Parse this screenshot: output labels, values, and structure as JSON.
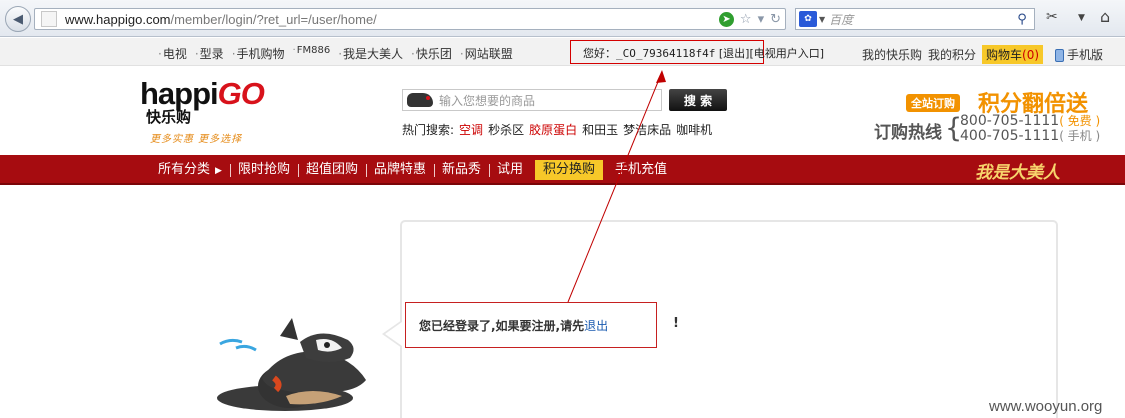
{
  "browser": {
    "url_domain": "www.happigo.com",
    "url_path": "/member/login/?ret_url=/user/home/",
    "search_placeholder": "百度"
  },
  "topbar": {
    "links": [
      "电视",
      "型录",
      "手机购物",
      "FM886",
      "我是大美人",
      "快乐团",
      "网站联盟"
    ],
    "greeting": "您好：",
    "user_id": "_CO_79364118f4f",
    "logout": "[退出]",
    "tv_entry": "[电视用户入口]",
    "my_happy_shop": "我的快乐购",
    "my_points": "我的积分",
    "cart_label": "购物车",
    "cart_count": "(0)",
    "mobile": "手机版"
  },
  "header": {
    "logo_text": "happi",
    "logo_go": "GO",
    "logo_chinese": "快乐购",
    "logo_tagline": "更多实惠 更多选择",
    "search_placeholder": "输入您想要的商品",
    "search_button": "搜 索",
    "hot_label": "热门搜索:",
    "hot_terms": [
      "空调",
      "秒杀区",
      "胶原蛋白",
      "和田玉",
      "梦洁床品",
      "咖啡机"
    ],
    "promo_tag": "全站订购",
    "promo_main": "积分翻倍送",
    "hotline_label": "订购热线",
    "hotline_1": "800-705-1111",
    "hotline_1_note": "( 免费 )",
    "hotline_2": "400-705-1111",
    "hotline_2_note": "( 手机 )"
  },
  "nav": {
    "items": [
      "所有分类",
      "限时抢购",
      "超值团购",
      "品牌特惠",
      "新品秀",
      "试用",
      "积分换购",
      "手机充值"
    ],
    "slogan": "我是大美人"
  },
  "main": {
    "message": "您已经登录了,如果要注册,请先",
    "logout_link": "退出",
    "exclaim": "!"
  },
  "watermark": "www.wooyun.org",
  "colors": {
    "nav_red": "#a60c10",
    "accent_orange": "#f29200",
    "highlight_yellow": "#f7c829",
    "annotation_red": "#d40000"
  }
}
